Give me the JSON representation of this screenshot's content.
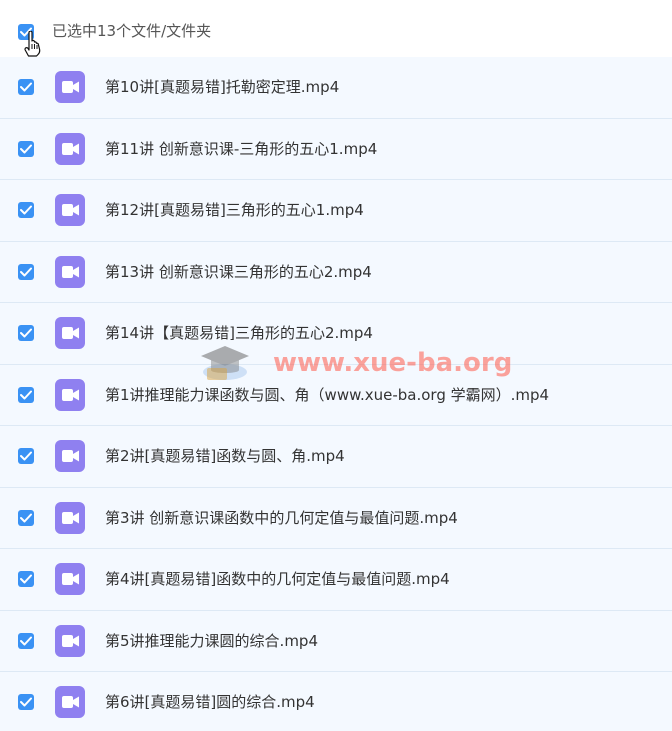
{
  "header": {
    "selection_label": "已选中13个文件/文件夹"
  },
  "files": [
    {
      "name": "第10讲[真题易错]托勒密定理.mp4"
    },
    {
      "name": "第11讲 创新意识课-三角形的五心1.mp4"
    },
    {
      "name": "第12讲[真题易错]三角形的五心1.mp4"
    },
    {
      "name": "第13讲 创新意识课三角形的五心2.mp4"
    },
    {
      "name": "第14讲【真题易错]三角形的五心2.mp4"
    },
    {
      "name": "第1讲推理能力课函数与圆、角（www.xue-ba.org 学霸网）.mp4"
    },
    {
      "name": "第2讲[真题易错]函数与圆、角.mp4"
    },
    {
      "name": "第3讲 创新意识课函数中的几何定值与最值问题.mp4"
    },
    {
      "name": "第4讲[真题易错]函数中的几何定值与最值问题.mp4"
    },
    {
      "name": "第5讲推理能力课圆的综合.mp4"
    },
    {
      "name": "第6讲[真题易错]圆的综合.mp4"
    }
  ],
  "watermark": {
    "text": "www.xue-ba.org"
  },
  "colors": {
    "checkbox": "#3a92f4",
    "video_icon": "#8f80f0",
    "row_background": "#f4f9ff",
    "watermark": "#ff5a4a"
  },
  "icons": {
    "checkbox": "check-icon",
    "file": "video-file-icon",
    "cursor": "hand-pointer-cursor"
  }
}
